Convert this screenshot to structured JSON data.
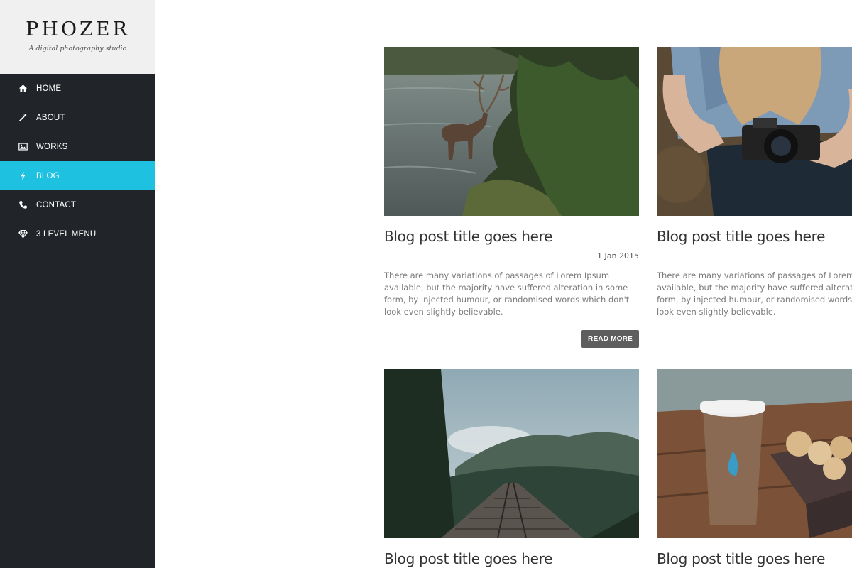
{
  "brand": {
    "title": "PHOZER",
    "tagline": "A digital photography studio"
  },
  "nav": {
    "items": [
      {
        "label": "HOME",
        "icon": "home-icon"
      },
      {
        "label": "ABOUT",
        "icon": "magic-wand-icon"
      },
      {
        "label": "WORKS",
        "icon": "image-icon"
      },
      {
        "label": "BLOG",
        "icon": "bolt-icon",
        "active": true
      },
      {
        "label": "CONTACT",
        "icon": "phone-icon"
      },
      {
        "label": "3 LEVEL MENU",
        "icon": "diamond-icon"
      }
    ],
    "active_color": "#1fc1e0",
    "background_color": "#212529"
  },
  "posts": [
    {
      "title": "Blog post title goes here",
      "date": "1 Jan 2015",
      "excerpt": "There are many variations of passages of Lorem Ipsum available, but the majority have suffered alteration in some form, by injected humour, or randomised words which don't look even slightly believable.",
      "read_more": "READ MORE",
      "image": "deer-in-river-photo"
    },
    {
      "title": "Blog post title goes here",
      "excerpt": "There are many variations of passages of Lorem Ipsum available, but the majority have suffered alteration in some form, by injected humour, or randomised words which don't look even slightly believable.",
      "image": "woman-with-camera-photo"
    },
    {
      "title": "Blog post title goes here",
      "image": "railway-bridge-forest-photo"
    },
    {
      "title": "Blog post title goes here",
      "image": "coffee-cup-macarons-photo"
    }
  ]
}
